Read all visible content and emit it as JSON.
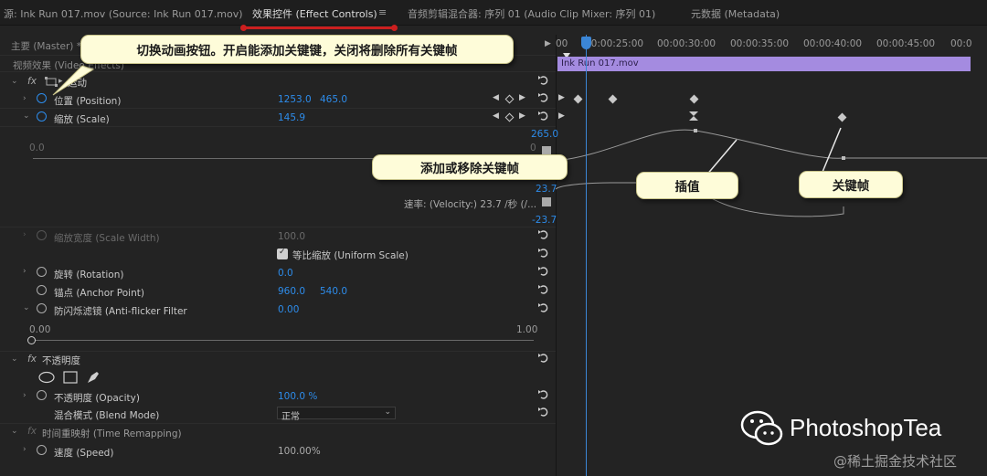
{
  "tabs": {
    "source": "源: Ink Run 017.mov (Source: Ink Run 017.mov)",
    "effect_controls": "效果控件 (Effect Controls)",
    "menu_glyph": "≡",
    "audio_mixer": "音频剪辑混合器: 序列 01 (Audio Clip Mixer: 序列 01)",
    "metadata": "元数据 (Metadata)"
  },
  "header": {
    "master_label": "主要 (Master) *",
    "play_glyph": "▶",
    "video_effects": "视频效果 (Video Effects)"
  },
  "timeline": {
    "ruler": [
      "00",
      "00:00:25:00",
      "00:00:30:00",
      "00:00:35:00",
      "00:00:40:00",
      "00:00:45:00",
      "00:0"
    ],
    "clip_name": "Ink Run 017.mov",
    "graph_top": "265.0",
    "graph_vel_top": "23.7",
    "graph_vel_bottom": "-23.7"
  },
  "motion": {
    "fx": "fx",
    "label": "运动",
    "position_label": "位置 (Position)",
    "position_x": "1253.0",
    "position_y": "465.0",
    "scale_label": "缩放 (Scale)",
    "scale_value": "145.9",
    "graph_min": "0.0",
    "graph_max_short": "0",
    "velocity_label": "速率: (Velocity:) 23.7 /秒 (/...",
    "scale_width_label": "缩放宽度 (Scale Width)",
    "scale_width_value": "100.0",
    "uniform_label": "等比缩放 (Uniform Scale)",
    "rotation_label": "旋转 (Rotation)",
    "rotation_value": "0.0",
    "anchor_label": "锚点 (Anchor Point)",
    "anchor_x": "960.0",
    "anchor_y": "540.0",
    "antiflicker_label": "防闪烁滤镜 (Anti-flicker Filter",
    "antiflicker_value": "0.00",
    "slider_min": "0.00",
    "slider_max": "1.00"
  },
  "opacity": {
    "fx": "fx",
    "label": "不透明度",
    "opacity_label": "不透明度 (Opacity)",
    "opacity_value": "100.0 %",
    "blend_label": "混合模式 (Blend Mode)",
    "blend_value": "正常"
  },
  "time_remap": {
    "fx": "fx",
    "label": "时间重映射 (Time Remapping)",
    "speed_label": "速度 (Speed)",
    "speed_value": "100.00%"
  },
  "callouts": {
    "toggle_animation": "切换动画按钮。开启能添加关键键，关闭将删除所有关键帧",
    "add_remove_keyframe": "添加或移除关键帧",
    "interpolation": "插值",
    "keyframe": "关键帧"
  },
  "watermark": {
    "brand": "PhotoshopTea",
    "site": "@稀土掘金技术社区"
  },
  "colors": {
    "accent_blue": "#2d8ceb",
    "clip_purple": "#a48be0",
    "tab_underline_red": "#cc1f1f",
    "callout_bg": "#fefcd9"
  }
}
